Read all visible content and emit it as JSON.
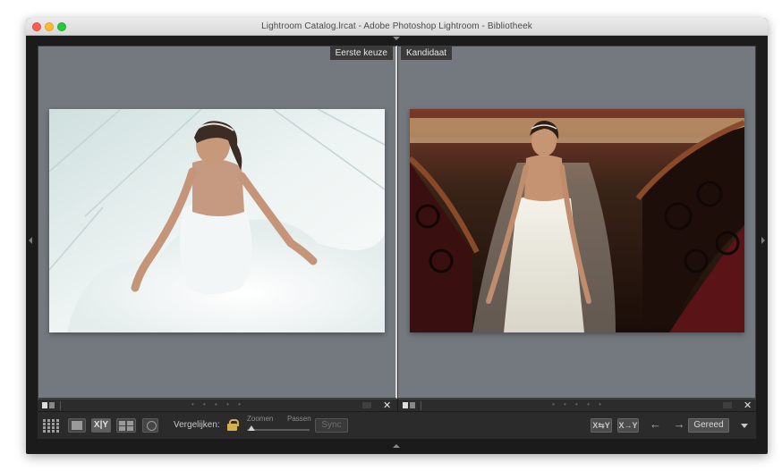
{
  "window": {
    "title": "Lightroom Catalog.lrcat - Adobe Photoshop Lightroom - Bibliotheek"
  },
  "panes": {
    "left_label": "Eerste keuze",
    "right_label": "Kandidaat"
  },
  "pane_bar": {
    "dots": "• • • • •",
    "close": "✕"
  },
  "toolbar": {
    "xy_label": "X|Y",
    "compare_label": "Vergelijken:",
    "zoom_label": "Zoomen",
    "fit_label": "Passen",
    "sync_label": "Sync",
    "swap_label": "X⇆Y",
    "swap2_label": "X→Y",
    "nav_label": "← →",
    "done_label": "Gereed"
  },
  "icons": {
    "grid": "grid-view-icon",
    "loupe": "loupe-view-icon",
    "survey": "survey-view-icon",
    "people": "people-view-icon",
    "lock": "lock-icon",
    "swap": "swap-icon",
    "make_select": "make-select-icon"
  },
  "colors": {
    "pane_bg": "#74797f",
    "lock": "#d4b04a",
    "toolbar_bg": "#2b2b2b"
  }
}
